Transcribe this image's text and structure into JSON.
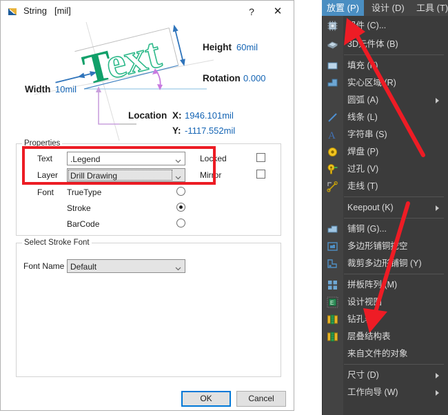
{
  "dialog": {
    "title": "String",
    "units": "[mil]",
    "title_icon": "string-tool-icon",
    "help_label": "?",
    "close_label": "✕",
    "preview": {
      "sample_text": "Text",
      "height_label": "Height",
      "height_value": "60mil",
      "rotation_label": "Rotation",
      "rotation_value": "0.000",
      "width_label": "Width",
      "width_value": "10mil",
      "location_label": "Location",
      "location_x_label": "X:",
      "location_x_value": "1946.101mil",
      "location_y_label": "Y:",
      "location_y_value": "-1117.552mil"
    },
    "properties": {
      "legend": "Properties",
      "text_label": "Text",
      "text_value": ".Legend",
      "layer_label": "Layer",
      "layer_value": "Drill Drawing",
      "locked_label": "Locked",
      "locked_checked": false,
      "mirror_label": "Mirror",
      "mirror_checked": false,
      "font_label": "Font",
      "font_options": [
        {
          "label": "TrueType",
          "selected": false
        },
        {
          "label": "Stroke",
          "selected": true
        },
        {
          "label": "BarCode",
          "selected": false
        }
      ]
    },
    "stroke_font": {
      "legend": "Select Stroke Font",
      "font_name_label": "Font Name",
      "font_name_value": "Default"
    },
    "buttons": {
      "ok": "OK",
      "cancel": "Cancel"
    }
  },
  "menu_panel": {
    "menubar": [
      {
        "label": "放置 (P)",
        "active": true
      },
      {
        "label": "设计 (D)",
        "active": false
      },
      {
        "label": "工具 (T)",
        "active": false
      }
    ],
    "items": [
      {
        "label": "器件 (C)...",
        "icon": "component-icon",
        "submenu": false,
        "sep_after": false
      },
      {
        "label": "3D元件体 (B)",
        "icon": "3d-body-icon",
        "submenu": false,
        "sep_after": true
      },
      {
        "label": "填充 (F)",
        "icon": "fill-icon",
        "submenu": false,
        "sep_after": false
      },
      {
        "label": "实心区域 (R)",
        "icon": "solid-region-icon",
        "submenu": false,
        "sep_after": false
      },
      {
        "label": "圆弧 (A)",
        "icon": "none",
        "submenu": true,
        "sep_after": false
      },
      {
        "label": "线条 (L)",
        "icon": "line-icon",
        "submenu": false,
        "sep_after": false
      },
      {
        "label": "字符串 (S)",
        "icon": "string-icon",
        "submenu": false,
        "sep_after": false
      },
      {
        "label": "焊盘 (P)",
        "icon": "pad-icon",
        "submenu": false,
        "sep_after": false
      },
      {
        "label": "过孔 (V)",
        "icon": "via-icon",
        "submenu": false,
        "sep_after": false
      },
      {
        "label": "走线 (T)",
        "icon": "track-icon",
        "submenu": false,
        "sep_after": true
      },
      {
        "label": "Keepout (K)",
        "icon": "none",
        "submenu": true,
        "sep_after": true
      },
      {
        "label": "铺铜 (G)...",
        "icon": "polygon-pour-icon",
        "submenu": false,
        "sep_after": false
      },
      {
        "label": "多边形铺铜挖空",
        "icon": "polygon-cutout-icon",
        "submenu": false,
        "sep_after": false
      },
      {
        "label": "裁剪多边形铺铜 (Y)",
        "icon": "polygon-slice-icon",
        "submenu": false,
        "sep_after": true
      },
      {
        "label": "拼板阵列 (M)",
        "icon": "panel-array-icon",
        "submenu": false,
        "sep_after": false
      },
      {
        "label": "设计视图",
        "icon": "design-view-icon",
        "submenu": false,
        "sep_after": false
      },
      {
        "label": "钻孔表",
        "icon": "drill-table-icon",
        "submenu": false,
        "sep_after": false
      },
      {
        "label": "层叠结构表",
        "icon": "layer-stack-table-icon",
        "submenu": false,
        "sep_after": false
      },
      {
        "label": "来自文件的对象",
        "icon": "none",
        "submenu": false,
        "sep_after": true
      },
      {
        "label": "尺寸 (D)",
        "icon": "none",
        "submenu": true,
        "sep_after": false
      },
      {
        "label": "工作向导 (W)",
        "icon": "none",
        "submenu": true,
        "sep_after": false
      }
    ]
  },
  "annotations": {
    "highlight_color": "#ec1c24",
    "arrow_color": "#ee1c25",
    "arrow_count": 2
  }
}
